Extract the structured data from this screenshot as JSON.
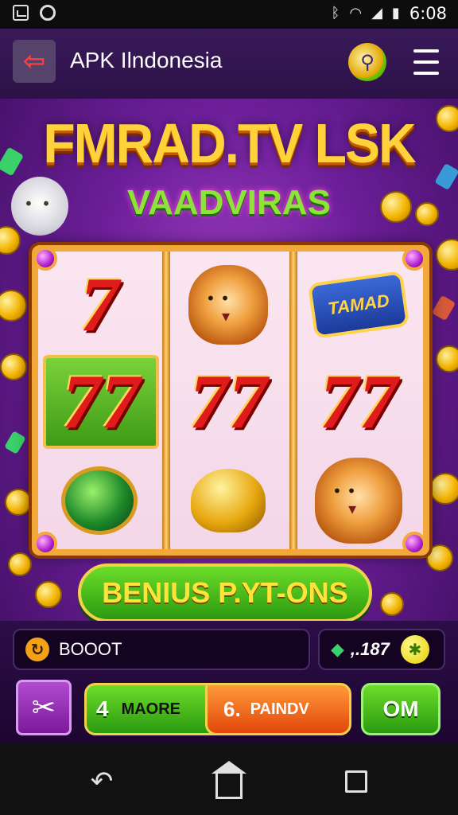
{
  "status_bar": {
    "time": "6:08",
    "icons": [
      "image-icon",
      "circle-icon",
      "bluetooth-icon",
      "wifi-icon",
      "signal-icon",
      "battery-icon"
    ]
  },
  "app_bar": {
    "title": "APK Ilndonesia",
    "back_icon": "back-arrow-icon",
    "search_icon": "search-icon",
    "menu_icon": "menu-icon"
  },
  "game": {
    "logo_title": "FMRAD.TV LSK",
    "logo_subtitle": "VAADVIRAS",
    "reels": [
      {
        "top": "7",
        "middle": "77",
        "bottom": "green-orb"
      },
      {
        "top": "tiger",
        "middle": "77",
        "bottom": "gold-bell"
      },
      {
        "top": "TAMAD",
        "middle": "77",
        "bottom": "lion"
      }
    ],
    "bonus_button": "BENIUS P.YT-ONS",
    "colors": {
      "accent_green": "#2b9a10",
      "accent_gold": "#f2d24a",
      "background_purple": "#6d1f9a"
    }
  },
  "panel": {
    "boost_label": "BOOOT",
    "boost_icon_glyph": "↻",
    "balance_value": ",.187",
    "balance_coin_glyph": "✱",
    "more_number": "4",
    "more_label": "MAORE",
    "pay_number": "6.",
    "pay_label": "PAINDV",
    "om_label": "OM",
    "tool_icon": "wand-tool-icon"
  },
  "nav_bar": {
    "icons": [
      "back-nav-icon",
      "home-nav-icon",
      "recent-apps-icon"
    ]
  }
}
